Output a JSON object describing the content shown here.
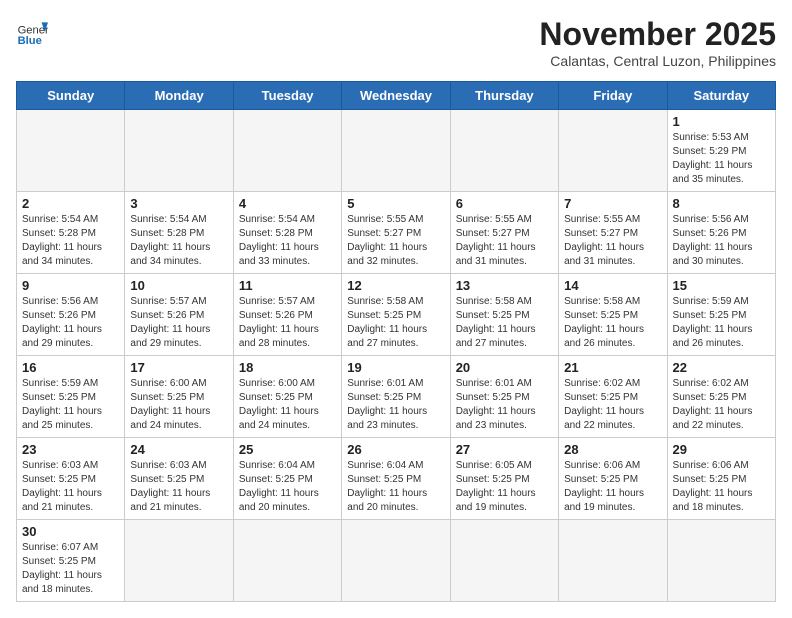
{
  "header": {
    "logo_line1": "General",
    "logo_line2": "Blue",
    "month_title": "November 2025",
    "location": "Calantas, Central Luzon, Philippines"
  },
  "days_of_week": [
    "Sunday",
    "Monday",
    "Tuesday",
    "Wednesday",
    "Thursday",
    "Friday",
    "Saturday"
  ],
  "weeks": [
    [
      {
        "day": "",
        "info": ""
      },
      {
        "day": "",
        "info": ""
      },
      {
        "day": "",
        "info": ""
      },
      {
        "day": "",
        "info": ""
      },
      {
        "day": "",
        "info": ""
      },
      {
        "day": "",
        "info": ""
      },
      {
        "day": "1",
        "info": "Sunrise: 5:53 AM\nSunset: 5:29 PM\nDaylight: 11 hours\nand 35 minutes."
      }
    ],
    [
      {
        "day": "2",
        "info": "Sunrise: 5:54 AM\nSunset: 5:28 PM\nDaylight: 11 hours\nand 34 minutes."
      },
      {
        "day": "3",
        "info": "Sunrise: 5:54 AM\nSunset: 5:28 PM\nDaylight: 11 hours\nand 34 minutes."
      },
      {
        "day": "4",
        "info": "Sunrise: 5:54 AM\nSunset: 5:28 PM\nDaylight: 11 hours\nand 33 minutes."
      },
      {
        "day": "5",
        "info": "Sunrise: 5:55 AM\nSunset: 5:27 PM\nDaylight: 11 hours\nand 32 minutes."
      },
      {
        "day": "6",
        "info": "Sunrise: 5:55 AM\nSunset: 5:27 PM\nDaylight: 11 hours\nand 31 minutes."
      },
      {
        "day": "7",
        "info": "Sunrise: 5:55 AM\nSunset: 5:27 PM\nDaylight: 11 hours\nand 31 minutes."
      },
      {
        "day": "8",
        "info": "Sunrise: 5:56 AM\nSunset: 5:26 PM\nDaylight: 11 hours\nand 30 minutes."
      }
    ],
    [
      {
        "day": "9",
        "info": "Sunrise: 5:56 AM\nSunset: 5:26 PM\nDaylight: 11 hours\nand 29 minutes."
      },
      {
        "day": "10",
        "info": "Sunrise: 5:57 AM\nSunset: 5:26 PM\nDaylight: 11 hours\nand 29 minutes."
      },
      {
        "day": "11",
        "info": "Sunrise: 5:57 AM\nSunset: 5:26 PM\nDaylight: 11 hours\nand 28 minutes."
      },
      {
        "day": "12",
        "info": "Sunrise: 5:58 AM\nSunset: 5:25 PM\nDaylight: 11 hours\nand 27 minutes."
      },
      {
        "day": "13",
        "info": "Sunrise: 5:58 AM\nSunset: 5:25 PM\nDaylight: 11 hours\nand 27 minutes."
      },
      {
        "day": "14",
        "info": "Sunrise: 5:58 AM\nSunset: 5:25 PM\nDaylight: 11 hours\nand 26 minutes."
      },
      {
        "day": "15",
        "info": "Sunrise: 5:59 AM\nSunset: 5:25 PM\nDaylight: 11 hours\nand 26 minutes."
      }
    ],
    [
      {
        "day": "16",
        "info": "Sunrise: 5:59 AM\nSunset: 5:25 PM\nDaylight: 11 hours\nand 25 minutes."
      },
      {
        "day": "17",
        "info": "Sunrise: 6:00 AM\nSunset: 5:25 PM\nDaylight: 11 hours\nand 24 minutes."
      },
      {
        "day": "18",
        "info": "Sunrise: 6:00 AM\nSunset: 5:25 PM\nDaylight: 11 hours\nand 24 minutes."
      },
      {
        "day": "19",
        "info": "Sunrise: 6:01 AM\nSunset: 5:25 PM\nDaylight: 11 hours\nand 23 minutes."
      },
      {
        "day": "20",
        "info": "Sunrise: 6:01 AM\nSunset: 5:25 PM\nDaylight: 11 hours\nand 23 minutes."
      },
      {
        "day": "21",
        "info": "Sunrise: 6:02 AM\nSunset: 5:25 PM\nDaylight: 11 hours\nand 22 minutes."
      },
      {
        "day": "22",
        "info": "Sunrise: 6:02 AM\nSunset: 5:25 PM\nDaylight: 11 hours\nand 22 minutes."
      }
    ],
    [
      {
        "day": "23",
        "info": "Sunrise: 6:03 AM\nSunset: 5:25 PM\nDaylight: 11 hours\nand 21 minutes."
      },
      {
        "day": "24",
        "info": "Sunrise: 6:03 AM\nSunset: 5:25 PM\nDaylight: 11 hours\nand 21 minutes."
      },
      {
        "day": "25",
        "info": "Sunrise: 6:04 AM\nSunset: 5:25 PM\nDaylight: 11 hours\nand 20 minutes."
      },
      {
        "day": "26",
        "info": "Sunrise: 6:04 AM\nSunset: 5:25 PM\nDaylight: 11 hours\nand 20 minutes."
      },
      {
        "day": "27",
        "info": "Sunrise: 6:05 AM\nSunset: 5:25 PM\nDaylight: 11 hours\nand 19 minutes."
      },
      {
        "day": "28",
        "info": "Sunrise: 6:06 AM\nSunset: 5:25 PM\nDaylight: 11 hours\nand 19 minutes."
      },
      {
        "day": "29",
        "info": "Sunrise: 6:06 AM\nSunset: 5:25 PM\nDaylight: 11 hours\nand 18 minutes."
      }
    ],
    [
      {
        "day": "30",
        "info": "Sunrise: 6:07 AM\nSunset: 5:25 PM\nDaylight: 11 hours\nand 18 minutes."
      },
      {
        "day": "",
        "info": ""
      },
      {
        "day": "",
        "info": ""
      },
      {
        "day": "",
        "info": ""
      },
      {
        "day": "",
        "info": ""
      },
      {
        "day": "",
        "info": ""
      },
      {
        "day": "",
        "info": ""
      }
    ]
  ]
}
